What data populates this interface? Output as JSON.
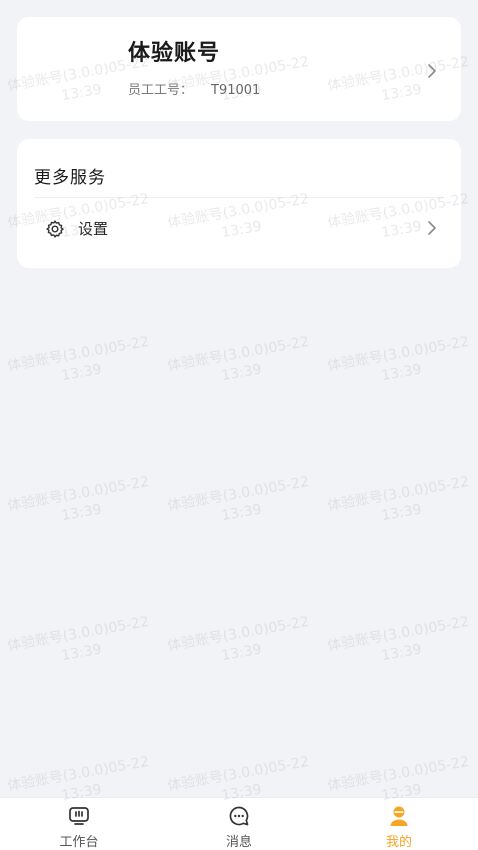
{
  "profile": {
    "name": "体验账号",
    "employee_label": "员工工号：",
    "employee_id": "T91001"
  },
  "services": {
    "title": "更多服务",
    "settings_label": "设置"
  },
  "tabbar": {
    "tabs": [
      {
        "label": "工作台",
        "icon": "workbench-icon"
      },
      {
        "label": "消息",
        "icon": "message-icon"
      },
      {
        "label": "我的",
        "icon": "profile-icon"
      }
    ],
    "active": "我的",
    "active_color": "#f5a623"
  },
  "watermark": {
    "line1": "体验账号(3.0.0)05-22",
    "line2": "13:39"
  },
  "colors": {
    "background": "#f2f3f7",
    "card": "#ffffff",
    "accent": "#f5a623"
  }
}
